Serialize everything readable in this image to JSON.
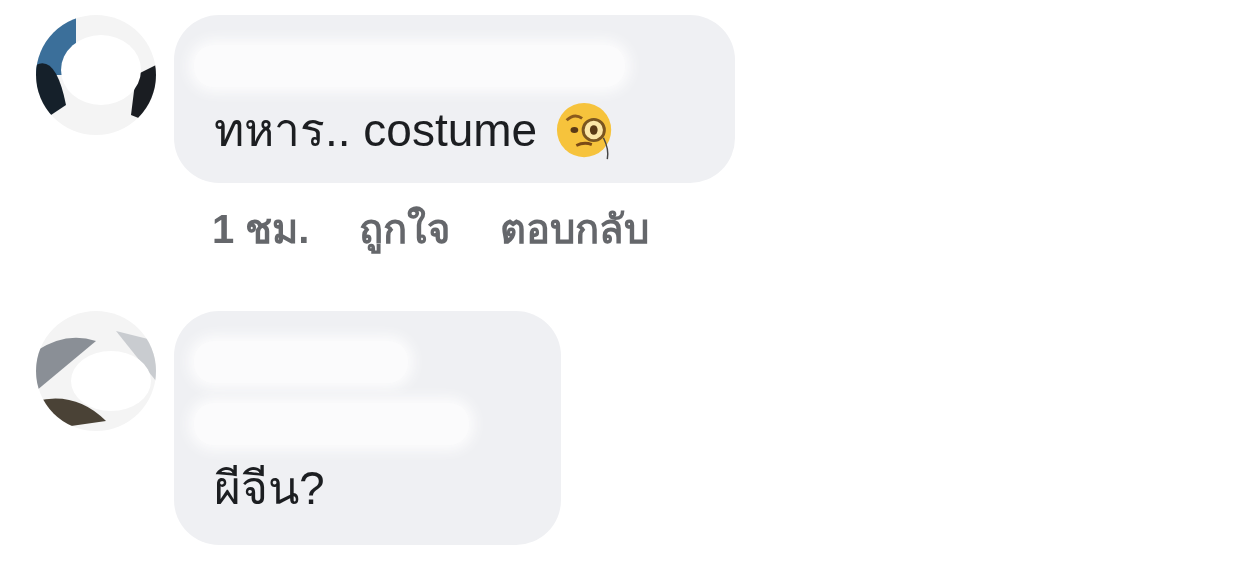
{
  "comments": [
    {
      "message": "ทหาร.. costume",
      "has_emoji": true,
      "badge": false,
      "meta": [
        "1 ชม.",
        "ถูกใจ",
        "ตอบกลับ"
      ]
    },
    {
      "message": "ผีจีน?",
      "has_emoji": false,
      "badge": true
    }
  ]
}
